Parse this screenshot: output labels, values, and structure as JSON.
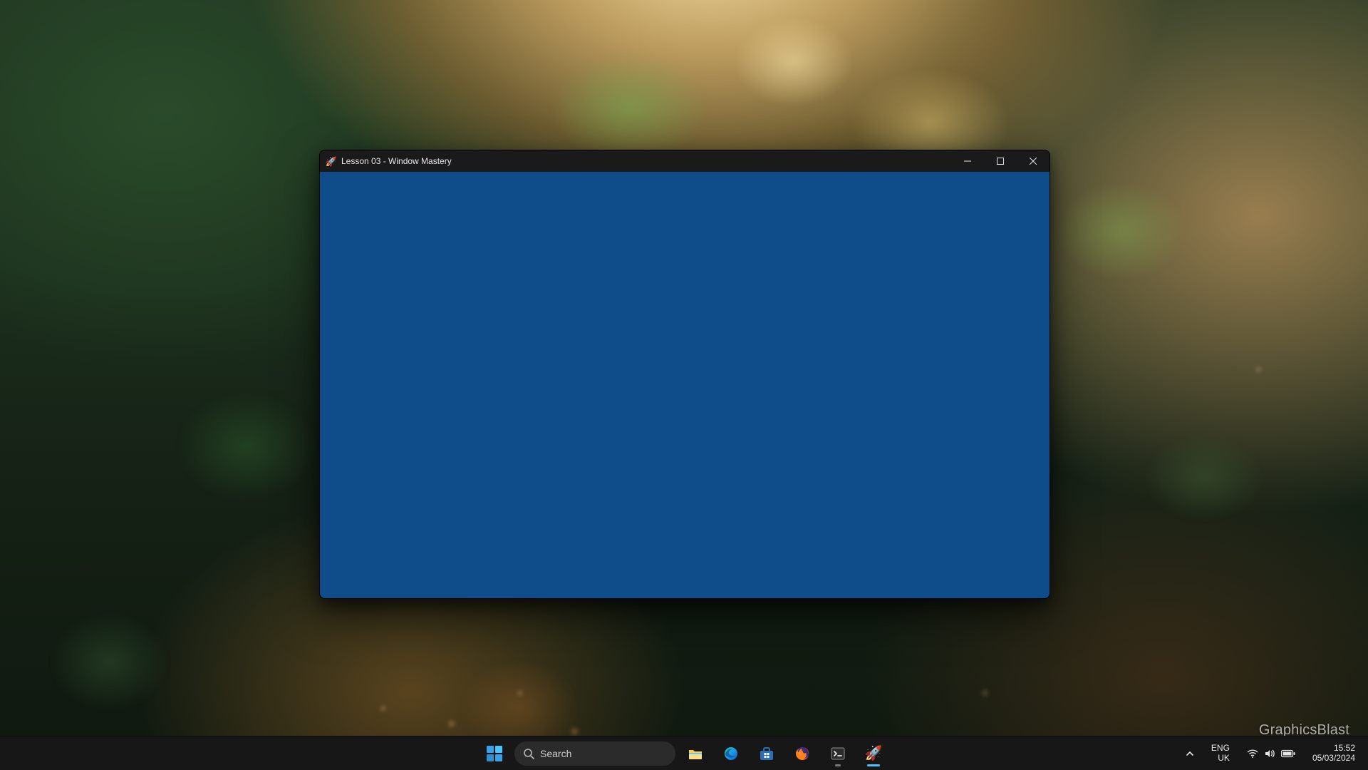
{
  "watermark": "GraphicsBlast",
  "window": {
    "title": "Lesson 03 - Window Mastery",
    "client_color": "#0f4d8a",
    "icon_name": "rocket-icon"
  },
  "taskbar": {
    "search_placeholder": "Search",
    "items": [
      {
        "name": "start",
        "icon": "start-icon"
      },
      {
        "name": "file-explorer",
        "icon": "file-explorer-icon"
      },
      {
        "name": "edge",
        "icon": "edge-icon"
      },
      {
        "name": "microsoft-store",
        "icon": "store-icon"
      },
      {
        "name": "firefox",
        "icon": "firefox-icon"
      },
      {
        "name": "terminal",
        "icon": "terminal-icon",
        "running": true
      },
      {
        "name": "lesson-app",
        "icon": "rocket-icon",
        "active": true
      }
    ]
  },
  "systray": {
    "language_primary": "ENG",
    "language_secondary": "UK",
    "time": "15:52",
    "date": "05/03/2024"
  }
}
